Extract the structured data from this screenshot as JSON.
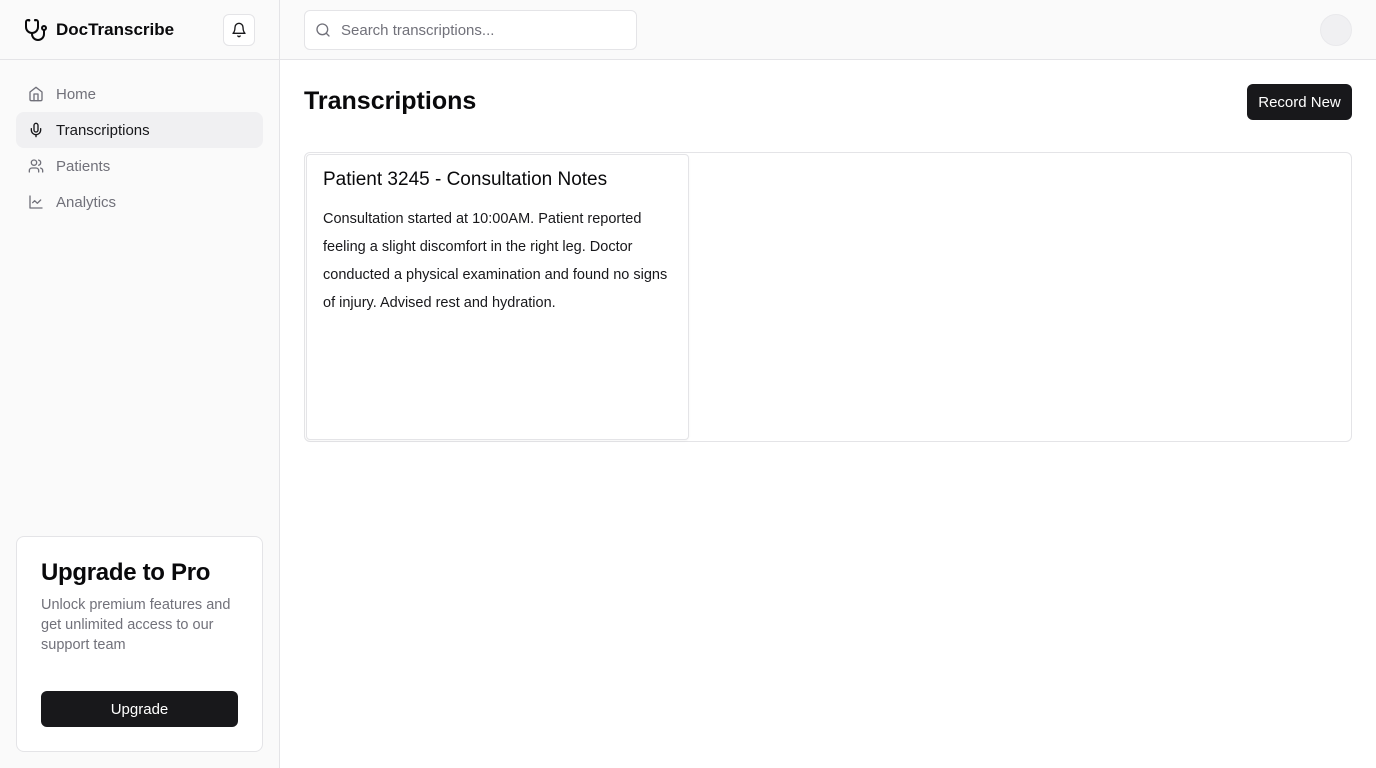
{
  "app": {
    "name": "DocTranscribe"
  },
  "sidebar": {
    "items": [
      {
        "label": "Home",
        "icon": "home-icon",
        "active": false
      },
      {
        "label": "Transcriptions",
        "icon": "mic-icon",
        "active": true
      },
      {
        "label": "Patients",
        "icon": "users-icon",
        "active": false
      },
      {
        "label": "Analytics",
        "icon": "line-chart-icon",
        "active": false
      }
    ]
  },
  "upgrade": {
    "title": "Upgrade to Pro",
    "description": "Unlock premium features and get unlimited access to our support team",
    "button_label": "Upgrade"
  },
  "search": {
    "placeholder": "Search transcriptions..."
  },
  "main": {
    "title": "Transcriptions",
    "record_button_label": "Record New",
    "transcriptions": [
      {
        "title": "Patient 3245 - Consultation Notes",
        "body": "Consultation started at 10:00AM. Patient reported feeling a slight discomfort in the right leg. Doctor conducted a physical examination and found no signs of injury. Advised rest and hydration."
      }
    ]
  },
  "colors": {
    "primary": "#18181b",
    "muted_text": "#71717a",
    "border": "#e4e4e7",
    "sidebar_bg": "#fafafa",
    "active_bg": "#f0f0f2"
  }
}
